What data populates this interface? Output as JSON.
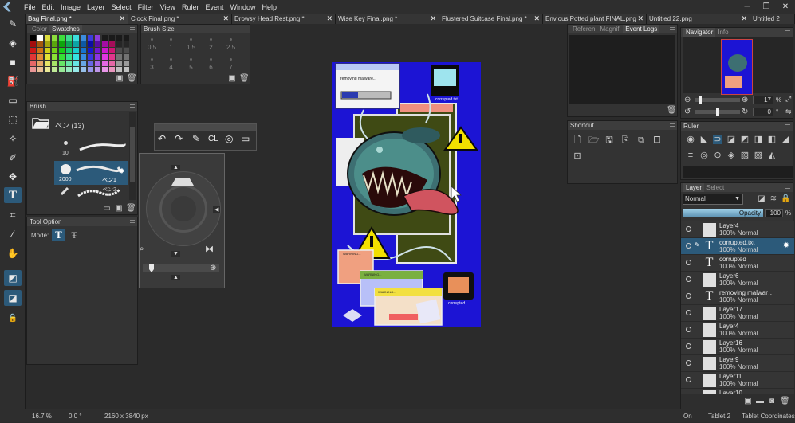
{
  "menu": [
    "File",
    "Edit",
    "Image",
    "Layer",
    "Select",
    "Filter",
    "View",
    "Ruler",
    "Event",
    "Window",
    "Help"
  ],
  "window_controls": {
    "minimize": "─",
    "maximize": "❐",
    "close": "✕"
  },
  "tabs": [
    {
      "label": "Bag Final.png *"
    },
    {
      "label": "Clock Final.png *"
    },
    {
      "label": "Drowsy Head Rest.png *"
    },
    {
      "label": "Wise Key Final.png *"
    },
    {
      "label": "Flustered Suitcase Final.png *"
    },
    {
      "label": "Envious Potted plant FINAL.png"
    },
    {
      "label": "Untitled 22.png"
    },
    {
      "label": "Untitled 2"
    }
  ],
  "tab_close": "✕",
  "color_panel": {
    "tabs": [
      "Color",
      "Swatches"
    ]
  },
  "brush_size_panel": {
    "title": "Brush Size",
    "sizes": [
      "0.5",
      "1",
      "1.5",
      "2",
      "2.5",
      "3",
      "4",
      "5",
      "6",
      "7"
    ]
  },
  "brush_panel": {
    "title": "Brush",
    "folder_label": "ペン (13)",
    "items": [
      {
        "size": "10",
        "name": ""
      },
      {
        "size": "2000",
        "name": "ペン1"
      },
      {
        "size": "",
        "name": "ペン2"
      }
    ]
  },
  "tool_option": {
    "title": "Tool Option",
    "mode_label": "Mode:"
  },
  "quick_toolbar": {
    "cl_label": "CL"
  },
  "reference_panel": {
    "tabs": [
      "Referen",
      "Magnifi",
      "Event Logs"
    ]
  },
  "navigator_panel": {
    "tabs": [
      "Navigator",
      "Info"
    ],
    "zoom": "17",
    "zoom_unit": "%",
    "rotation": "0",
    "rotation_unit": "°"
  },
  "shortcut_panel": {
    "title": "Shortcut"
  },
  "ruler_panel": {
    "title": "Ruler"
  },
  "layer_panel": {
    "tabs": [
      "Layer",
      "Select"
    ],
    "blend_mode": "Normal",
    "opacity_label": "Opacity",
    "opacity_value": "100",
    "opacity_unit": "%",
    "layers": [
      {
        "name": "Layer4",
        "mode": "100% Normal",
        "type": "raster",
        "selected": false
      },
      {
        "name": "corrupted.txt",
        "mode": "100% Normal",
        "type": "text",
        "selected": true
      },
      {
        "name": "corrupted",
        "mode": "100% Normal",
        "type": "text",
        "selected": false
      },
      {
        "name": "Layer6",
        "mode": "100% Normal",
        "type": "raster",
        "selected": false
      },
      {
        "name": "removing malwar…",
        "mode": "100% Normal",
        "type": "text",
        "selected": false
      },
      {
        "name": "Layer17",
        "mode": "100% Normal",
        "type": "raster",
        "selected": false
      },
      {
        "name": "Layer4",
        "mode": "100% Normal",
        "type": "raster",
        "selected": false
      },
      {
        "name": "Layer16",
        "mode": "100% Normal",
        "type": "raster",
        "selected": false
      },
      {
        "name": "Layer9",
        "mode": "100% Normal",
        "type": "raster",
        "selected": false
      },
      {
        "name": "Layer11",
        "mode": "100% Normal",
        "type": "raster",
        "selected": false
      },
      {
        "name": "Layer10",
        "mode": "",
        "type": "raster",
        "selected": false
      }
    ]
  },
  "canvas_art": {
    "popup_text": "removing malware...",
    "corrupted_label_top": "corrupted.txt",
    "corrupted_label_bottom": "corrupted",
    "warning_label": "WARNING...",
    "colors": {
      "bg": "#1c14d4",
      "panel": "#3f4a14",
      "monster": "#3d6f72",
      "tongue": "#d0545f",
      "warn": "#f2e000"
    }
  },
  "status": {
    "zoom": "16.7 %",
    "rotation": "0.0 °",
    "size": "2160 x 3840 px",
    "pen": "On",
    "tablet": "Tablet 2",
    "coords": "Tablet Coordinates"
  }
}
